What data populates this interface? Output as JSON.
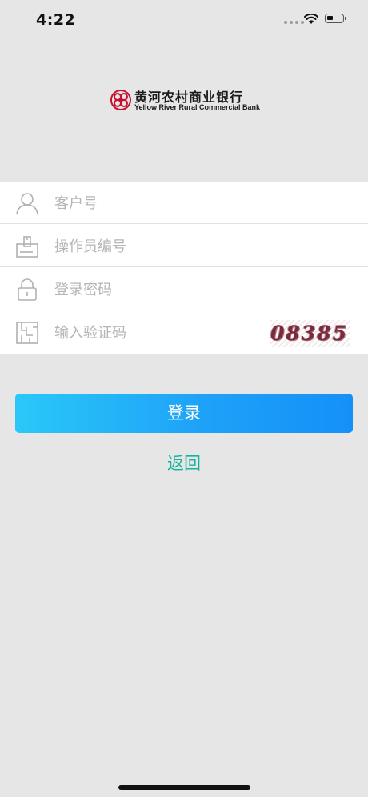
{
  "status_bar": {
    "time": "4:22"
  },
  "logo": {
    "name_cn": "黄河农村商业银行",
    "name_en": "Yellow River Rural Commercial Bank",
    "brand_color": "#c8102e"
  },
  "form": {
    "customer_no": {
      "placeholder": "客户号",
      "icon": "user-icon"
    },
    "operator_no": {
      "placeholder": "操作员编号",
      "icon": "operator-card-icon"
    },
    "password": {
      "placeholder": "登录密码",
      "icon": "lock-icon"
    },
    "captcha": {
      "placeholder": "输入验证码",
      "icon": "captcha-icon",
      "code": "08385"
    }
  },
  "actions": {
    "login_label": "登录",
    "back_label": "返回"
  },
  "colors": {
    "background": "#e6e6e6",
    "button_gradient_start": "#2ac8f8",
    "button_gradient_end": "#1590f8",
    "back_link": "#15b49e",
    "placeholder": "#b5b5b5"
  }
}
